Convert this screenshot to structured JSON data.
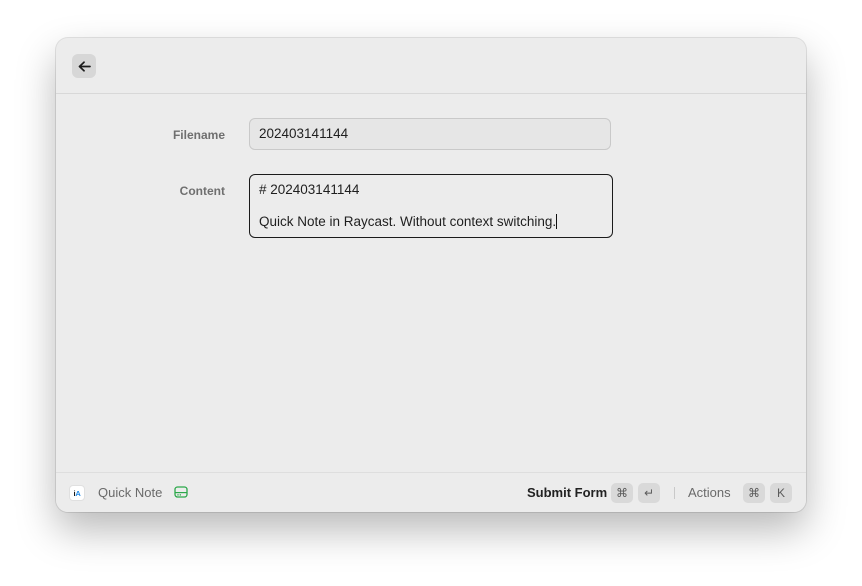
{
  "header": {
    "back_icon": "arrow-left-icon"
  },
  "form": {
    "filename": {
      "label": "Filename",
      "value": "202403141144"
    },
    "content": {
      "label": "Content",
      "line1": "# 202403141144",
      "line2": "",
      "line3": "Quick Note in Raycast. Without context switching."
    }
  },
  "footer": {
    "app_icon_text_main": "i",
    "app_icon_text_accent": "A",
    "title": "Quick Note",
    "status_icon": "hard-drive-icon",
    "status_color": "#2ba84a",
    "primary_action": "Submit Form",
    "primary_keys": [
      "⌘",
      "↵"
    ],
    "secondary_action": "Actions",
    "secondary_keys": [
      "⌘",
      "K"
    ]
  }
}
